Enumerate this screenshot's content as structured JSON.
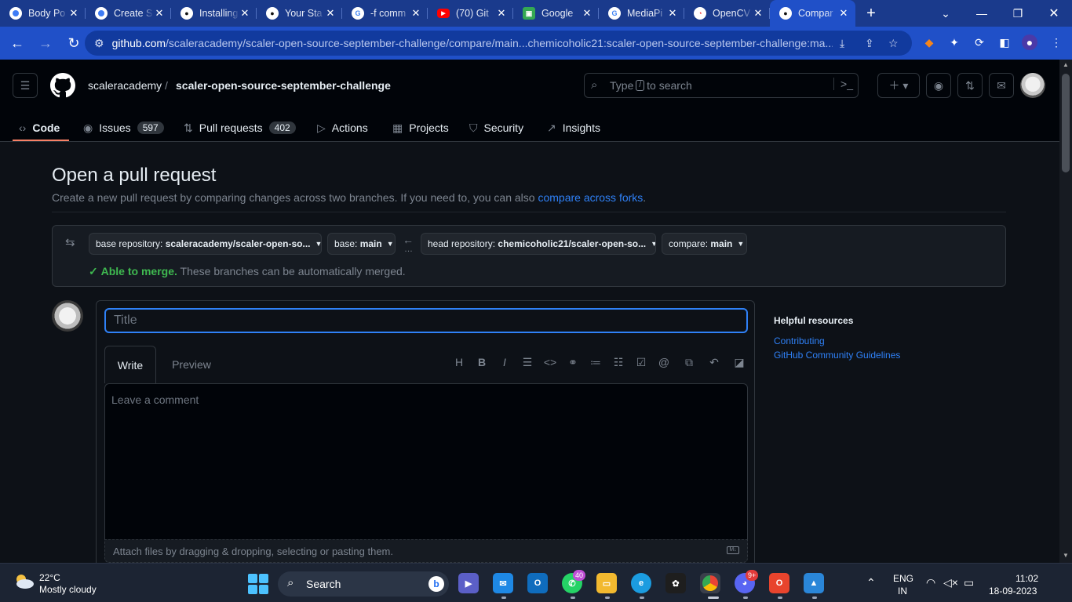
{
  "browser": {
    "tabs": [
      {
        "title": "Body Po",
        "favicon_color": "#3d7bf5",
        "favicon": "circle"
      },
      {
        "title": "Create S",
        "favicon_color": "#3d7bf5",
        "favicon": "circle"
      },
      {
        "title": "Installing",
        "favicon_color": "#ffffff",
        "favicon": "github-icon"
      },
      {
        "title": "Your Sta",
        "favicon_color": "#ffffff",
        "favicon": "github-icon"
      },
      {
        "title": "-f comm",
        "favicon_color": "#ffffff",
        "favicon": "google-icon"
      },
      {
        "title": "(70) Git",
        "favicon_color": "#ff0000",
        "favicon": "youtube-icon"
      },
      {
        "title": "Google",
        "favicon_color": "#34a853",
        "favicon": "google-meet-icon"
      },
      {
        "title": "MediaPi",
        "favicon_color": "#ffffff",
        "favicon": "google-icon"
      },
      {
        "title": "OpenCV",
        "favicon_color": "#ffffff",
        "favicon": "opencv-icon"
      },
      {
        "title": "Compar",
        "favicon_color": "#ffffff",
        "favicon": "github-icon",
        "active": true
      }
    ],
    "url_host": "github.com",
    "url_path": "/scaleracademy/scaler-open-source-september-challenge/compare/main...chemicoholic21:scaler-open-source-september-challenge:ma..."
  },
  "github": {
    "owner": "scaleracademy",
    "repo": "scaler-open-source-september-challenge",
    "search_placeholder_pre": "Type",
    "search_key": "/",
    "search_placeholder_post": "to search",
    "nav": [
      {
        "label": "Code",
        "icon": "code-icon",
        "selected": true
      },
      {
        "label": "Issues",
        "icon": "issue-icon",
        "count": "597"
      },
      {
        "label": "Pull requests",
        "icon": "pull-request-icon",
        "count": "402"
      },
      {
        "label": "Actions",
        "icon": "play-icon"
      },
      {
        "label": "Projects",
        "icon": "table-icon"
      },
      {
        "label": "Security",
        "icon": "shield-icon"
      },
      {
        "label": "Insights",
        "icon": "graph-icon"
      }
    ]
  },
  "compare": {
    "title": "Open a pull request",
    "description": "Create a new pull request by comparing changes across two branches. If you need to, you can also",
    "description_link": "compare across forks",
    "base_repo_label": "base repository:",
    "base_repo_value": "scaleracademy/scaler-open-so...",
    "base_label": "base:",
    "base_value": "main",
    "head_repo_label": "head repository:",
    "head_repo_value": "chemicoholic21/scaler-open-so...",
    "compare_label": "compare:",
    "compare_value": "main",
    "merge_status": "Able to merge.",
    "merge_detail": "These branches can be automatically merged."
  },
  "composer": {
    "title_placeholder": "Title",
    "tab_write": "Write",
    "tab_preview": "Preview",
    "comment_placeholder": "Leave a comment",
    "attach_hint": "Attach files by dragging & dropping, selecting or pasting them."
  },
  "sidebar": {
    "heading": "Helpful resources",
    "links": [
      "Contributing",
      "GitHub Community Guidelines"
    ]
  },
  "taskbar": {
    "temp": "22°C",
    "weather": "Mostly cloudy",
    "search": "Search",
    "lang1": "ENG",
    "lang2": "IN",
    "time": "11:02",
    "date": "18-09-2023",
    "whatsapp_badge": "40",
    "discord_badge": "9+"
  }
}
